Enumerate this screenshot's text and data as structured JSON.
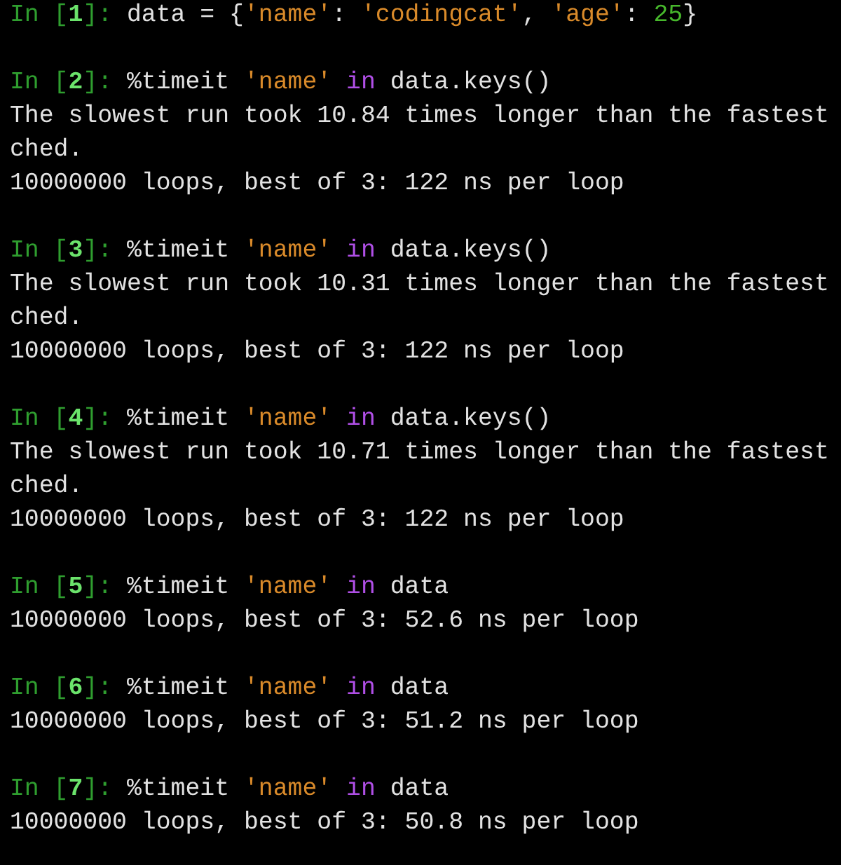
{
  "cells": [
    {
      "input": [
        {
          "kind": "prompt",
          "text": "In ["
        },
        {
          "kind": "prompt-number",
          "text": "1"
        },
        {
          "kind": "prompt",
          "text": "]: "
        },
        {
          "kind": "plain",
          "text": "data = {"
        },
        {
          "kind": "string",
          "text": "'name'"
        },
        {
          "kind": "plain",
          "text": ": "
        },
        {
          "kind": "string",
          "text": "'codingcat'"
        },
        {
          "kind": "plain",
          "text": ", "
        },
        {
          "kind": "string",
          "text": "'age'"
        },
        {
          "kind": "plain",
          "text": ": "
        },
        {
          "kind": "number",
          "text": "25"
        },
        {
          "kind": "plain",
          "text": "}"
        }
      ]
    },
    {
      "input": [
        {
          "kind": "prompt",
          "text": "In ["
        },
        {
          "kind": "prompt-number",
          "text": "2"
        },
        {
          "kind": "prompt",
          "text": "]: "
        },
        {
          "kind": "plain",
          "text": "%timeit "
        },
        {
          "kind": "string",
          "text": "'name'"
        },
        {
          "kind": "keyword",
          "text": " in"
        },
        {
          "kind": "plain",
          "text": " data.keys()"
        }
      ],
      "output": [
        "The slowest run took 10.84 times longer than the fastest",
        "ched.",
        "10000000 loops, best of 3: 122 ns per loop"
      ]
    },
    {
      "input": [
        {
          "kind": "prompt",
          "text": "In ["
        },
        {
          "kind": "prompt-number",
          "text": "3"
        },
        {
          "kind": "prompt",
          "text": "]: "
        },
        {
          "kind": "plain",
          "text": "%timeit "
        },
        {
          "kind": "string",
          "text": "'name'"
        },
        {
          "kind": "keyword",
          "text": " in"
        },
        {
          "kind": "plain",
          "text": " data.keys()"
        }
      ],
      "output": [
        "The slowest run took 10.31 times longer than the fastest",
        "ched.",
        "10000000 loops, best of 3: 122 ns per loop"
      ]
    },
    {
      "input": [
        {
          "kind": "prompt",
          "text": "In ["
        },
        {
          "kind": "prompt-number",
          "text": "4"
        },
        {
          "kind": "prompt",
          "text": "]: "
        },
        {
          "kind": "plain",
          "text": "%timeit "
        },
        {
          "kind": "string",
          "text": "'name'"
        },
        {
          "kind": "keyword",
          "text": " in"
        },
        {
          "kind": "plain",
          "text": " data.keys()"
        }
      ],
      "output": [
        "The slowest run took 10.71 times longer than the fastest",
        "ched.",
        "10000000 loops, best of 3: 122 ns per loop"
      ]
    },
    {
      "input": [
        {
          "kind": "prompt",
          "text": "In ["
        },
        {
          "kind": "prompt-number",
          "text": "5"
        },
        {
          "kind": "prompt",
          "text": "]: "
        },
        {
          "kind": "plain",
          "text": "%timeit "
        },
        {
          "kind": "string",
          "text": "'name'"
        },
        {
          "kind": "keyword",
          "text": " in"
        },
        {
          "kind": "plain",
          "text": " data"
        }
      ],
      "output": [
        "10000000 loops, best of 3: 52.6 ns per loop"
      ]
    },
    {
      "input": [
        {
          "kind": "prompt",
          "text": "In ["
        },
        {
          "kind": "prompt-number",
          "text": "6"
        },
        {
          "kind": "prompt",
          "text": "]: "
        },
        {
          "kind": "plain",
          "text": "%timeit "
        },
        {
          "kind": "string",
          "text": "'name'"
        },
        {
          "kind": "keyword",
          "text": " in"
        },
        {
          "kind": "plain",
          "text": " data"
        }
      ],
      "output": [
        "10000000 loops, best of 3: 51.2 ns per loop"
      ]
    },
    {
      "input": [
        {
          "kind": "prompt",
          "text": "In ["
        },
        {
          "kind": "prompt-number",
          "text": "7"
        },
        {
          "kind": "prompt",
          "text": "]: "
        },
        {
          "kind": "plain",
          "text": "%timeit "
        },
        {
          "kind": "string",
          "text": "'name'"
        },
        {
          "kind": "keyword",
          "text": " in"
        },
        {
          "kind": "plain",
          "text": " data"
        }
      ],
      "output": [
        "10000000 loops, best of 3: 50.8 ns per loop"
      ]
    }
  ]
}
